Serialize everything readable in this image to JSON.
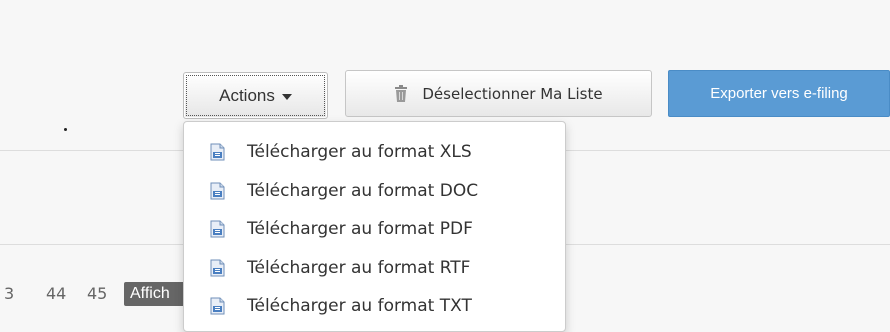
{
  "toolbar": {
    "actions_label": "Actions",
    "deselect_label": "Déselectionner Ma Liste",
    "export_label": "Exporter vers e-filing"
  },
  "actions_menu": {
    "items": [
      {
        "label": "Télécharger au format XLS",
        "icon": "download-file-icon"
      },
      {
        "label": "Télécharger au format DOC",
        "icon": "download-file-icon"
      },
      {
        "label": "Télécharger au format PDF",
        "icon": "download-file-icon"
      },
      {
        "label": "Télécharger au format RTF",
        "icon": "download-file-icon"
      },
      {
        "label": "Télécharger au format TXT",
        "icon": "download-file-icon"
      }
    ]
  },
  "pagination": {
    "page_a": "3",
    "page_b": "44",
    "page_c": "45",
    "show_label": "Affich"
  },
  "colors": {
    "export_button": "#5a9bd4",
    "page_background": "#f7f7f7",
    "show_badge": "#666666"
  }
}
